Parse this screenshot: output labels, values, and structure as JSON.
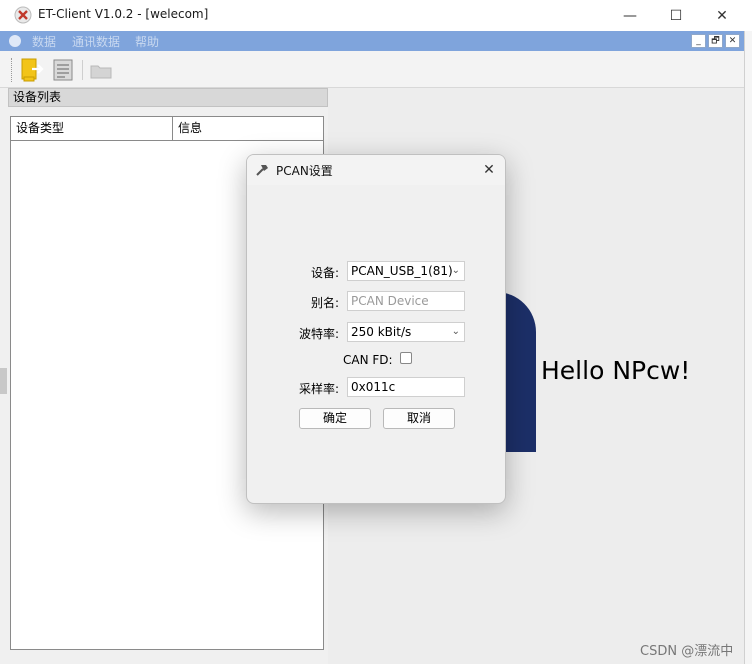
{
  "window": {
    "title": "ET-Client V1.0.2 - [welecom]",
    "minimize_glyph": "—",
    "maximize_glyph": "☐",
    "close_glyph": "✕"
  },
  "menubar": {
    "items": [
      {
        "label": "数据"
      },
      {
        "label": "通讯数据"
      },
      {
        "label": "帮助"
      }
    ],
    "mdi_min": "_",
    "mdi_restore": "🗗",
    "mdi_close": "✕"
  },
  "left_panel": {
    "title": "设备列表",
    "columns": [
      "设备类型",
      "信息"
    ]
  },
  "content": {
    "greeting": "Hello NPcw!",
    "accent_color": "#1c2f68"
  },
  "dialog": {
    "title": "PCAN设置",
    "fields": {
      "device_label": "设备:",
      "device_value": "PCAN_USB_1(81)",
      "alias_label": "别名:",
      "alias_placeholder": "PCAN Device",
      "baud_label": "波特率:",
      "baud_value": "250 kBit/s",
      "canfd_label": "CAN FD:",
      "sample_label": "采样率:",
      "sample_value": "0x011c"
    },
    "ok_label": "确定",
    "cancel_label": "取消"
  },
  "watermark": "CSDN @漂流中"
}
